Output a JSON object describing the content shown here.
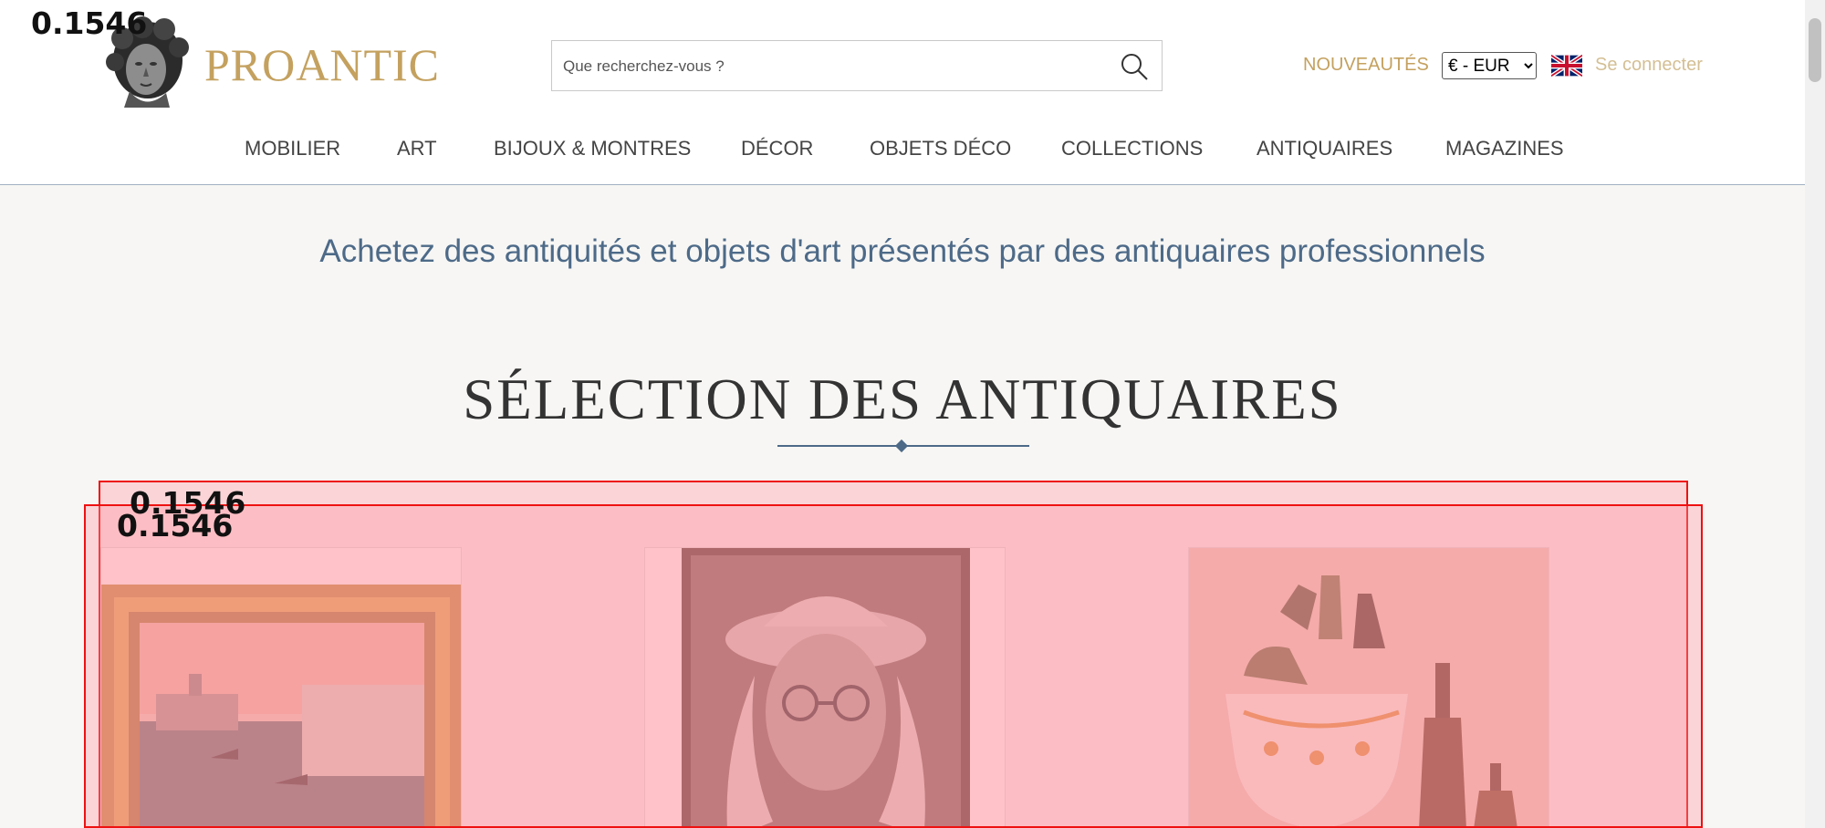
{
  "header": {
    "logo_text": "PROANTIC",
    "search": {
      "placeholder": "Que recherchez-vous ?"
    },
    "new_label": "NOUVEAUTÉS",
    "currency": {
      "selected": "€ - EUR"
    },
    "login_label": "Se connecter"
  },
  "nav": [
    "MOBILIER",
    "ART",
    "BIJOUX & MONTRES",
    "DÉCOR",
    "OBJETS DÉCO",
    "COLLECTIONS",
    "ANTIQUAIRES",
    "MAGAZINES"
  ],
  "main": {
    "tagline": "Achetez des antiquités et objets d'art présentés par des antiquaires professionnels",
    "section_title": "SÉLECTION DES ANTIQUAIRES"
  },
  "overlays": {
    "score_1": "0.1546",
    "score_2": "0.1546",
    "score_3": "0.1546"
  },
  "products": [
    {
      "image": "painting-venice-canal-icon"
    },
    {
      "image": "portrait-engraving-icon"
    },
    {
      "image": "bottles-and-faience-vase-icon"
    }
  ],
  "colors": {
    "gold": "#c4a15f",
    "blue": "#4d6a88",
    "overlay_red": "#e11111"
  }
}
